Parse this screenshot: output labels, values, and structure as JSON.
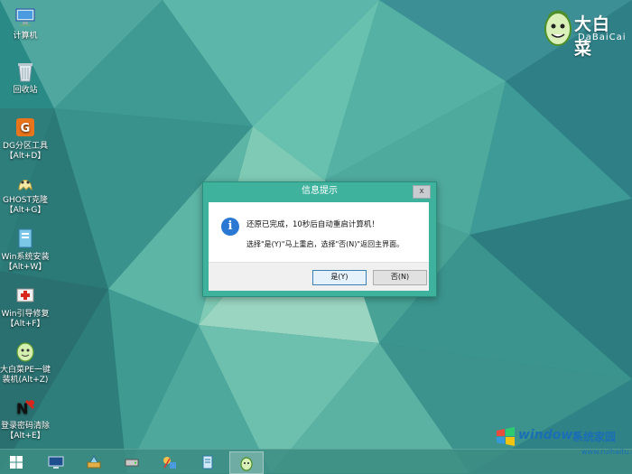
{
  "desktop": {
    "icons": [
      {
        "label1": "计算机",
        "label2": "",
        "icon": "computer-icon"
      },
      {
        "label1": "回收站",
        "label2": "",
        "icon": "recycle-bin-icon"
      },
      {
        "label1": "DG分区工具",
        "label2": "【Alt+D】",
        "icon": "diskgenius-icon"
      },
      {
        "label1": "GHOST克隆",
        "label2": "【Alt+G】",
        "icon": "ghost-icon"
      },
      {
        "label1": "Win系统安装",
        "label2": "【Alt+W】",
        "icon": "win-install-icon"
      },
      {
        "label1": "Win引导修复",
        "label2": "【Alt+F】",
        "icon": "boot-repair-icon"
      },
      {
        "label1": "大白菜PE一键",
        "label2": "装机(Alt+Z)",
        "icon": "dabaicai-install-icon"
      },
      {
        "label1": "登录密码清除",
        "label2": "【Alt+E】",
        "icon": "password-clear-icon"
      }
    ]
  },
  "brand": {
    "title": "大白菜",
    "subtitle": "DaBaiCai"
  },
  "dialog": {
    "title": "信息提示",
    "close": "x",
    "message1": "还原已完成，10秒后自动重启计算机！",
    "message2": "选择\"是(Y)\"马上重启，选择\"否(N)\"返回主界面。",
    "yes_label": "是(Y)",
    "no_label": "否(N)"
  },
  "taskbar": {
    "items": [
      "start-icon",
      "screen-icon",
      "tools-icon",
      "disk-icon",
      "network-icon",
      "notepad-icon",
      "dabaicai-icon"
    ]
  },
  "watermark": {
    "text1": "windows",
    "text2": "系统家园",
    "url": "www.ruihaitu.com"
  },
  "colors": {
    "accent": "#3fb29d",
    "info": "#2a78d4",
    "taskbar": "#3c8c82"
  }
}
